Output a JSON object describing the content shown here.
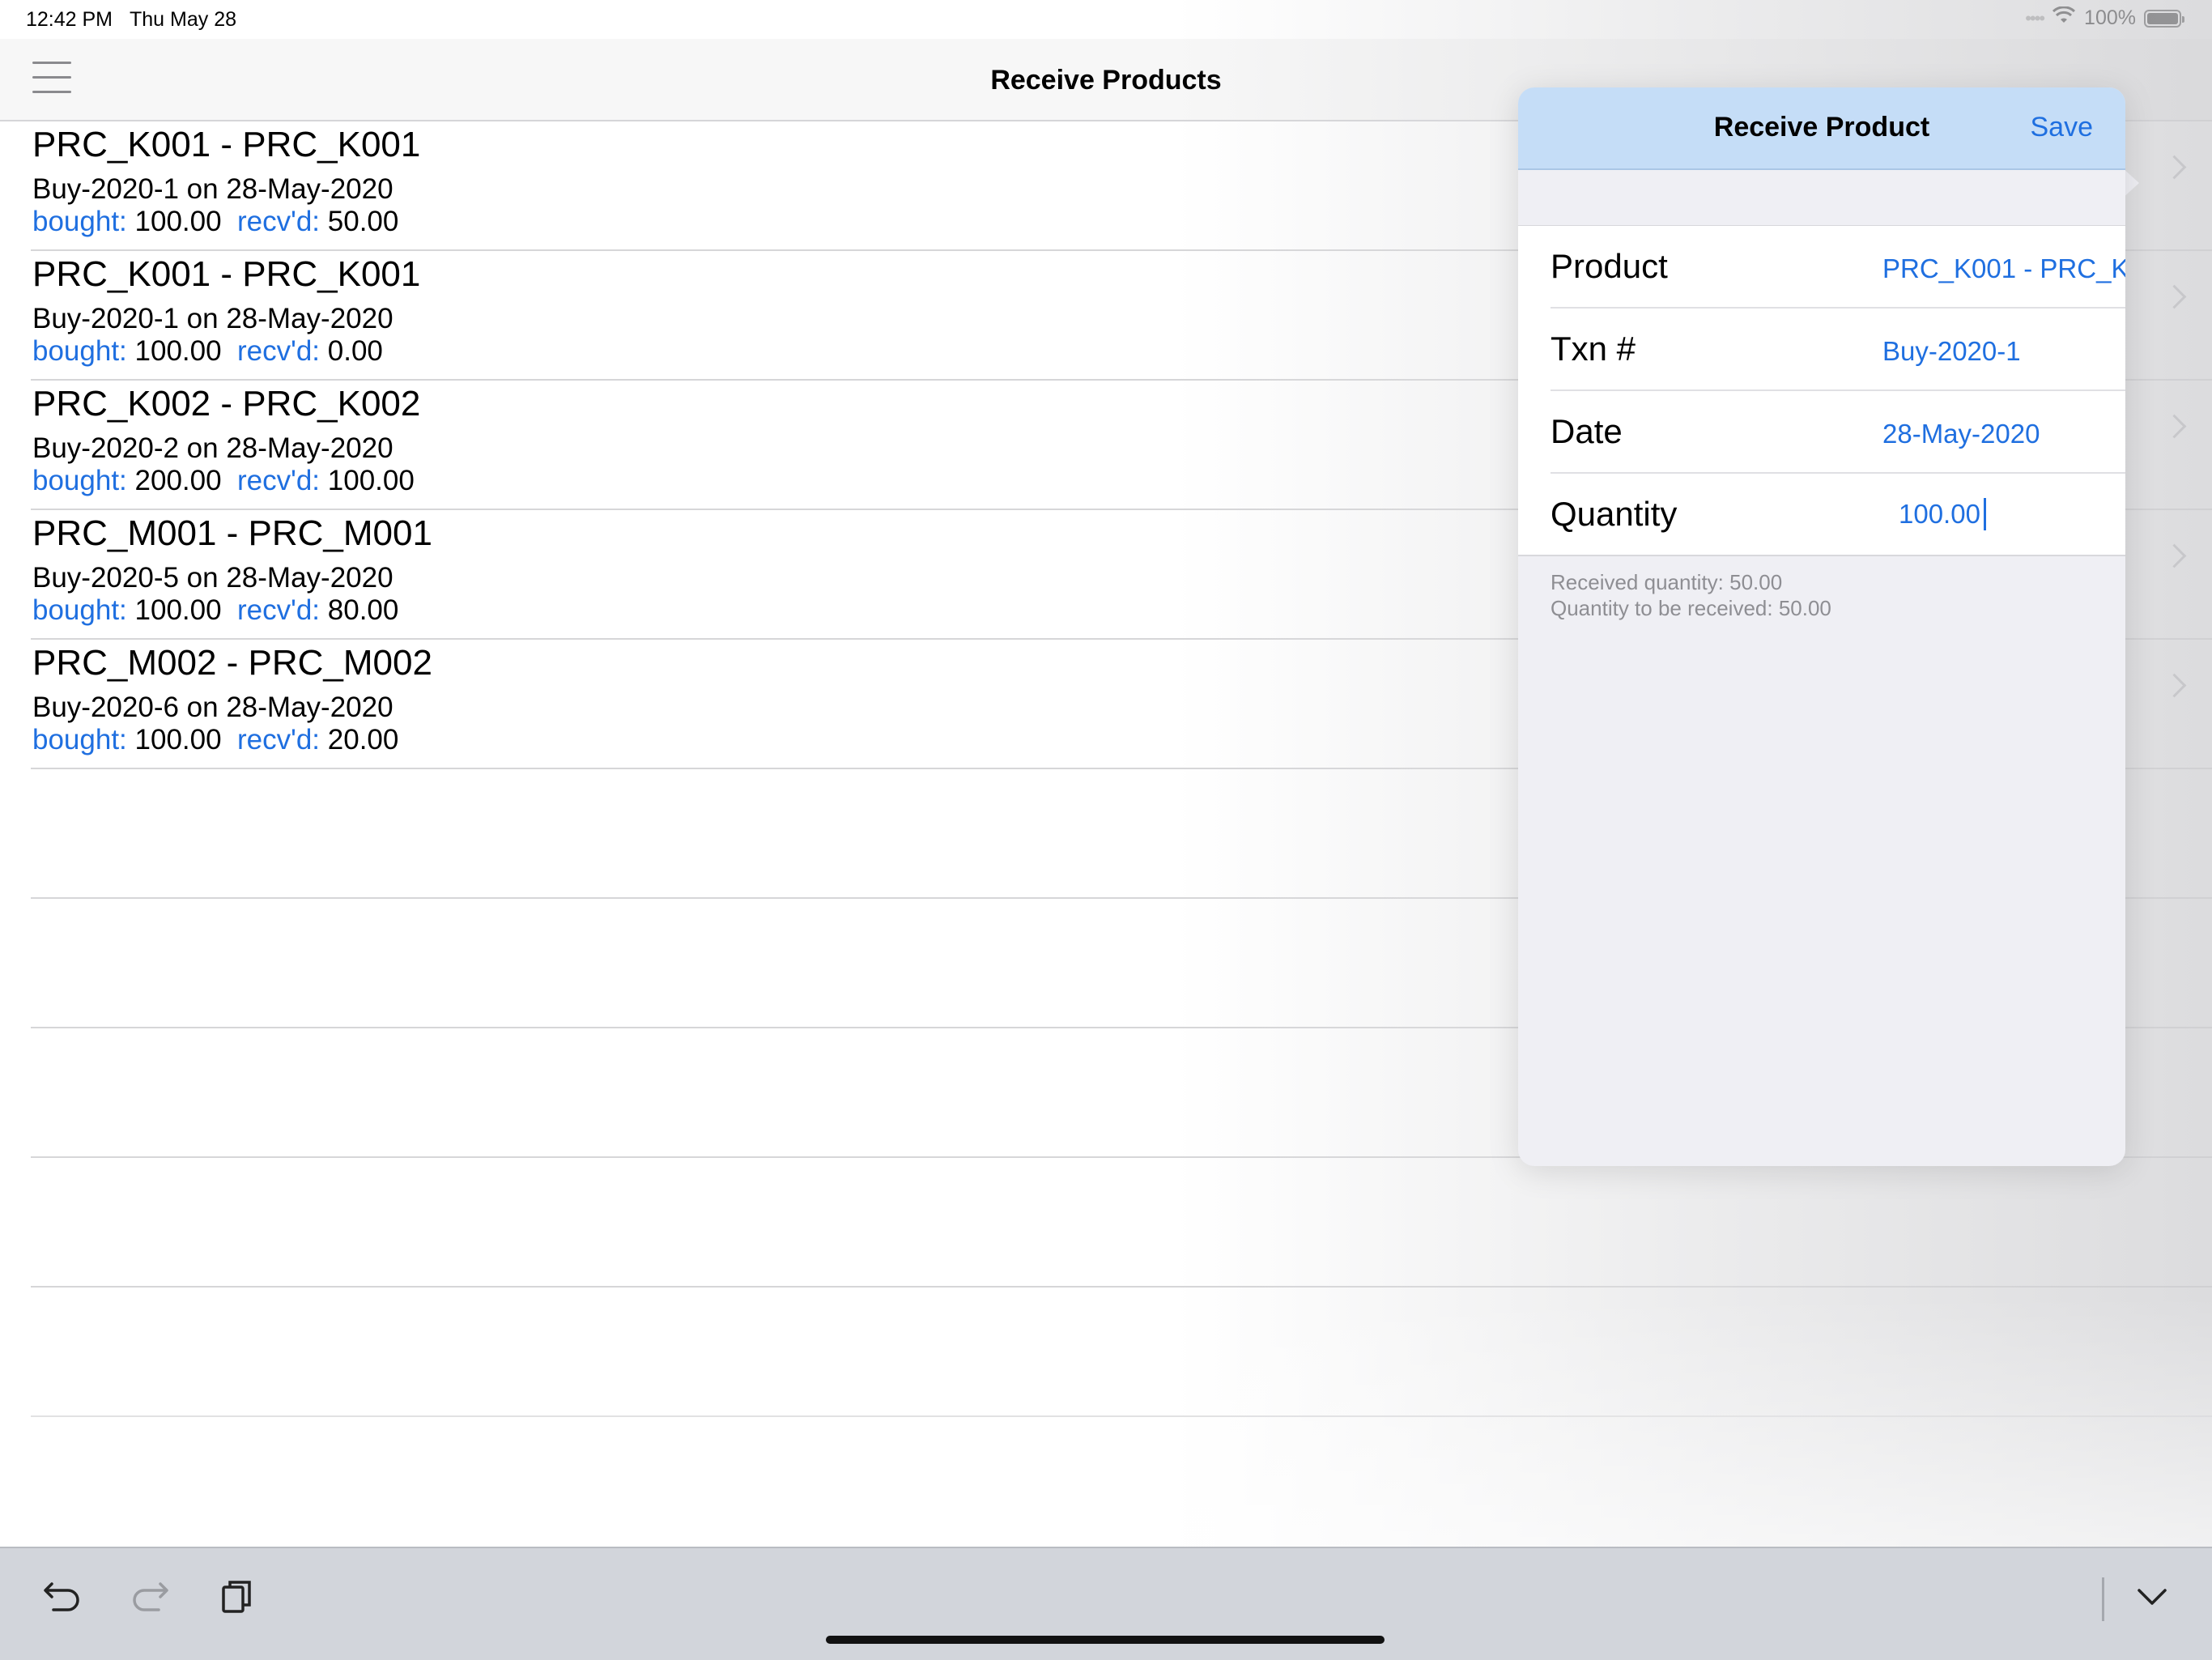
{
  "status": {
    "time": "12:42 PM",
    "date": "Thu May 28",
    "battery": "100%"
  },
  "navbar": {
    "title": "Receive Products"
  },
  "list": {
    "bought_label": "bought:",
    "recvd_label": "recv'd:",
    "items": [
      {
        "title": "PRC_K001 - PRC_K001",
        "subtitle": "Buy-2020-1 on 28-May-2020",
        "bought": "100.00",
        "recvd": "50.00"
      },
      {
        "title": "PRC_K001 - PRC_K001",
        "subtitle": "Buy-2020-1 on 28-May-2020",
        "bought": "100.00",
        "recvd": "0.00"
      },
      {
        "title": "PRC_K002 - PRC_K002",
        "subtitle": "Buy-2020-2 on 28-May-2020",
        "bought": "200.00",
        "recvd": "100.00"
      },
      {
        "title": "PRC_M001 - PRC_M001",
        "subtitle": "Buy-2020-5 on 28-May-2020",
        "bought": "100.00",
        "recvd": "80.00"
      },
      {
        "title": "PRC_M002 - PRC_M002",
        "subtitle": "Buy-2020-6 on 28-May-2020",
        "bought": "100.00",
        "recvd": "20.00"
      }
    ]
  },
  "popover": {
    "title": "Receive Product",
    "save_label": "Save",
    "fields": {
      "product": {
        "label": "Product",
        "value": "PRC_K001 - PRC_K..."
      },
      "txn": {
        "label": "Txn #",
        "value": "Buy-2020-1"
      },
      "date": {
        "label": "Date",
        "value": "28-May-2020"
      },
      "quantity": {
        "label": "Quantity",
        "value": "100.00"
      }
    },
    "notes": {
      "received": "Received quantity: 50.00",
      "to_receive": "Quantity to be received: 50.00"
    }
  },
  "toolbar": {
    "undo_icon": "undo-icon",
    "redo_icon": "redo-icon",
    "paste_icon": "clipboard-icon",
    "dismiss_icon": "chevron-down-icon"
  },
  "colors": {
    "accent": "#1f6fe0",
    "popover_header": "#c5ddf7",
    "toolbar": "#d2d5db"
  }
}
